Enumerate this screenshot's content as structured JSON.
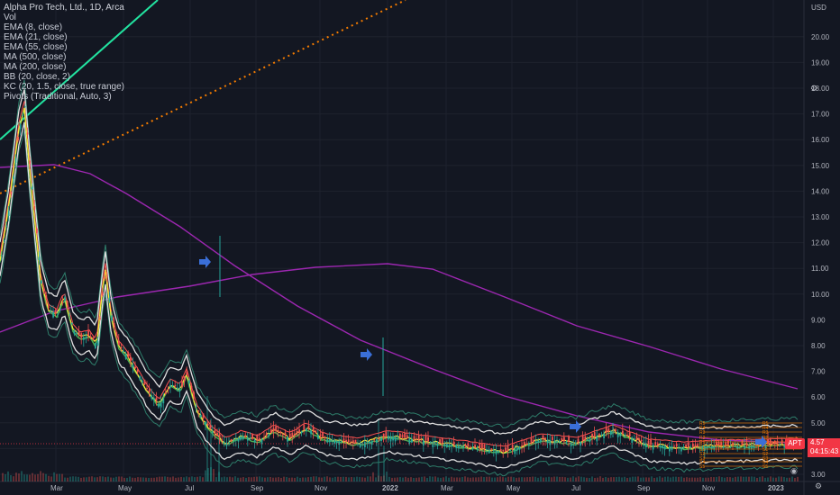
{
  "legend": {
    "title": "Alpha Pro Tech, Ltd., 1D, Arca",
    "indicators": [
      "Vol",
      "EMA (8, close)",
      "EMA (21, close)",
      "EMA (55, close)",
      "MA (500, close)",
      "MA (200, close)",
      "BB (20, close, 2)",
      "KC (20, 1.5, close, true range)",
      "Pivots (Traditional, Auto, 3)"
    ]
  },
  "price_axis": {
    "currency": "USD",
    "last_price": "4.57",
    "countdown": "04:15:43",
    "symbol_tag": "APT"
  },
  "colors": {
    "background": "#131722",
    "grid": "#1e222d",
    "up": "#26a69a",
    "down": "#ef5350",
    "ema8": "#ffeb3b",
    "ema21": "#4caf50",
    "ema55": "#ff5252",
    "ma200": "#9c27b0",
    "bb": "#e0e0e0",
    "kc": "#2e7d6a",
    "trend_solid": "#22e3a0",
    "trend_dotted": "#f57c00",
    "pivots": "#f57c00",
    "arrow": "#2962ff",
    "price_tag": "#f23645"
  },
  "icons": [
    "arrow-right-icon",
    "settings-icon",
    "auto-scale-icon"
  ],
  "chart_data": {
    "type": "candlestick",
    "title": "Alpha Pro Tech, Ltd., 1D, Arca",
    "y_axis": {
      "unit": "USD",
      "ticks": [
        "20.00",
        "19.00",
        "18.00",
        "17.00",
        "16.00",
        "15.00",
        "14.00",
        "13.00",
        "12.00",
        "11.00",
        "10.00",
        "9.00",
        "8.00",
        "7.00",
        "6.00",
        "5.00",
        "4.00",
        "3.00"
      ],
      "ylim": [
        2.9,
        21.4
      ]
    },
    "x_axis": {
      "ticks": [
        "Mar",
        "May",
        "Jul",
        "Sep",
        "Nov",
        "2022",
        "Mar",
        "May",
        "Jul",
        "Sep",
        "Nov",
        "2023"
      ]
    },
    "close_path": [
      [
        "2020-01-15",
        11.3
      ],
      [
        "2020-02-01",
        13.5
      ],
      [
        "2020-02-20",
        16.5
      ],
      [
        "2020-03-01",
        17.3
      ],
      [
        "2020-03-10",
        15.0
      ],
      [
        "2020-03-20",
        13.0
      ],
      [
        "2020-04-01",
        10.5
      ],
      [
        "2020-04-15",
        9.4
      ],
      [
        "2020-05-01",
        9.2
      ],
      [
        "2020-05-15",
        9.9
      ],
      [
        "2020-06-01",
        8.6
      ],
      [
        "2020-06-15",
        8.3
      ],
      [
        "2020-07-01",
        8.4
      ],
      [
        "2020-07-15",
        8.0
      ],
      [
        "2020-07-25",
        10.0
      ],
      [
        "2020-08-01",
        11.0
      ],
      [
        "2020-08-10",
        9.3
      ],
      [
        "2020-08-25",
        8.0
      ],
      [
        "2020-09-10",
        7.6
      ],
      [
        "2020-10-01",
        6.9
      ],
      [
        "2020-10-20",
        6.2
      ],
      [
        "2020-11-10",
        5.7
      ],
      [
        "2020-12-01",
        6.5
      ],
      [
        "2020-12-20",
        6.3
      ],
      [
        "2021-01-01",
        6.9
      ],
      [
        "2021-01-20",
        5.5
      ],
      [
        "2021-02-15",
        4.7
      ],
      [
        "2021-03-15",
        4.2
      ],
      [
        "2021-04-15",
        4.5
      ],
      [
        "2021-05-15",
        4.3
      ],
      [
        "2021-06-15",
        4.7
      ],
      [
        "2021-07-15",
        4.4
      ],
      [
        "2021-08-15",
        4.8
      ],
      [
        "2021-09-15",
        4.4
      ],
      [
        "2021-10-15",
        4.3
      ],
      [
        "2021-11-15",
        4.2
      ],
      [
        "2021-12-15",
        4.3
      ],
      [
        "2022-01-15",
        4.5
      ]
    ],
    "ma200_path": [
      [
        "2020-01-15",
        8.5
      ],
      [
        "2020-03-15",
        9.2
      ],
      [
        "2020-05-15",
        9.7
      ],
      [
        "2020-07-15",
        10.4
      ],
      [
        "2020-09-15",
        10.9
      ],
      [
        "2020-11-15",
        11.2
      ],
      [
        "2021-01-01",
        11.2
      ],
      [
        "2021-03-15",
        10.5
      ],
      [
        "2021-05-15",
        9.4
      ],
      [
        "2021-07-15",
        8.7
      ],
      [
        "2021-09-15",
        8.0
      ],
      [
        "2021-11-15",
        7.2
      ],
      [
        "2022-01-15",
        6.4
      ]
    ],
    "ma500_path": [
      [
        "2020-01-15",
        15.2
      ],
      [
        "2020-03-01",
        14.9
      ],
      [
        "2020-05-01",
        13.9
      ],
      [
        "2020-07-01",
        12.2
      ],
      [
        "2020-09-01",
        10.2
      ],
      [
        "2020-11-01",
        8.4
      ],
      [
        "2021-01-01",
        7.1
      ],
      [
        "2021-04-01",
        6.0
      ],
      [
        "2021-07-01",
        5.2
      ],
      [
        "2021-10-01",
        4.7
      ],
      [
        "2022-01-15",
        4.5
      ]
    ],
    "pivot_levels": [
      "R5",
      "R4",
      "R3",
      "R2",
      "R1",
      "P",
      "S1",
      "S2",
      "S3",
      "S4",
      "S5"
    ]
  }
}
